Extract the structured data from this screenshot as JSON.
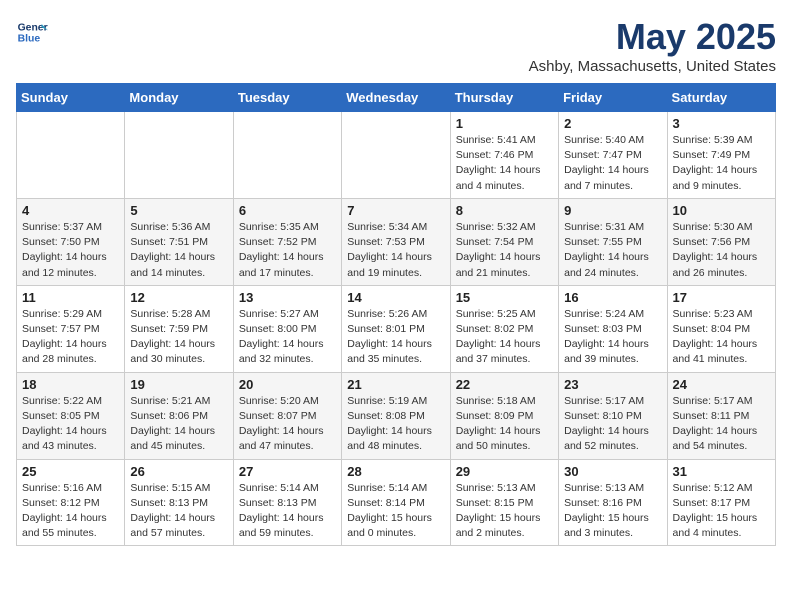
{
  "header": {
    "logo_line1": "General",
    "logo_line2": "Blue",
    "month_title": "May 2025",
    "location": "Ashby, Massachusetts, United States"
  },
  "weekdays": [
    "Sunday",
    "Monday",
    "Tuesday",
    "Wednesday",
    "Thursday",
    "Friday",
    "Saturday"
  ],
  "weeks": [
    [
      {
        "day": "",
        "info": ""
      },
      {
        "day": "",
        "info": ""
      },
      {
        "day": "",
        "info": ""
      },
      {
        "day": "",
        "info": ""
      },
      {
        "day": "1",
        "info": "Sunrise: 5:41 AM\nSunset: 7:46 PM\nDaylight: 14 hours\nand 4 minutes."
      },
      {
        "day": "2",
        "info": "Sunrise: 5:40 AM\nSunset: 7:47 PM\nDaylight: 14 hours\nand 7 minutes."
      },
      {
        "day": "3",
        "info": "Sunrise: 5:39 AM\nSunset: 7:49 PM\nDaylight: 14 hours\nand 9 minutes."
      }
    ],
    [
      {
        "day": "4",
        "info": "Sunrise: 5:37 AM\nSunset: 7:50 PM\nDaylight: 14 hours\nand 12 minutes."
      },
      {
        "day": "5",
        "info": "Sunrise: 5:36 AM\nSunset: 7:51 PM\nDaylight: 14 hours\nand 14 minutes."
      },
      {
        "day": "6",
        "info": "Sunrise: 5:35 AM\nSunset: 7:52 PM\nDaylight: 14 hours\nand 17 minutes."
      },
      {
        "day": "7",
        "info": "Sunrise: 5:34 AM\nSunset: 7:53 PM\nDaylight: 14 hours\nand 19 minutes."
      },
      {
        "day": "8",
        "info": "Sunrise: 5:32 AM\nSunset: 7:54 PM\nDaylight: 14 hours\nand 21 minutes."
      },
      {
        "day": "9",
        "info": "Sunrise: 5:31 AM\nSunset: 7:55 PM\nDaylight: 14 hours\nand 24 minutes."
      },
      {
        "day": "10",
        "info": "Sunrise: 5:30 AM\nSunset: 7:56 PM\nDaylight: 14 hours\nand 26 minutes."
      }
    ],
    [
      {
        "day": "11",
        "info": "Sunrise: 5:29 AM\nSunset: 7:57 PM\nDaylight: 14 hours\nand 28 minutes."
      },
      {
        "day": "12",
        "info": "Sunrise: 5:28 AM\nSunset: 7:59 PM\nDaylight: 14 hours\nand 30 minutes."
      },
      {
        "day": "13",
        "info": "Sunrise: 5:27 AM\nSunset: 8:00 PM\nDaylight: 14 hours\nand 32 minutes."
      },
      {
        "day": "14",
        "info": "Sunrise: 5:26 AM\nSunset: 8:01 PM\nDaylight: 14 hours\nand 35 minutes."
      },
      {
        "day": "15",
        "info": "Sunrise: 5:25 AM\nSunset: 8:02 PM\nDaylight: 14 hours\nand 37 minutes."
      },
      {
        "day": "16",
        "info": "Sunrise: 5:24 AM\nSunset: 8:03 PM\nDaylight: 14 hours\nand 39 minutes."
      },
      {
        "day": "17",
        "info": "Sunrise: 5:23 AM\nSunset: 8:04 PM\nDaylight: 14 hours\nand 41 minutes."
      }
    ],
    [
      {
        "day": "18",
        "info": "Sunrise: 5:22 AM\nSunset: 8:05 PM\nDaylight: 14 hours\nand 43 minutes."
      },
      {
        "day": "19",
        "info": "Sunrise: 5:21 AM\nSunset: 8:06 PM\nDaylight: 14 hours\nand 45 minutes."
      },
      {
        "day": "20",
        "info": "Sunrise: 5:20 AM\nSunset: 8:07 PM\nDaylight: 14 hours\nand 47 minutes."
      },
      {
        "day": "21",
        "info": "Sunrise: 5:19 AM\nSunset: 8:08 PM\nDaylight: 14 hours\nand 48 minutes."
      },
      {
        "day": "22",
        "info": "Sunrise: 5:18 AM\nSunset: 8:09 PM\nDaylight: 14 hours\nand 50 minutes."
      },
      {
        "day": "23",
        "info": "Sunrise: 5:17 AM\nSunset: 8:10 PM\nDaylight: 14 hours\nand 52 minutes."
      },
      {
        "day": "24",
        "info": "Sunrise: 5:17 AM\nSunset: 8:11 PM\nDaylight: 14 hours\nand 54 minutes."
      }
    ],
    [
      {
        "day": "25",
        "info": "Sunrise: 5:16 AM\nSunset: 8:12 PM\nDaylight: 14 hours\nand 55 minutes."
      },
      {
        "day": "26",
        "info": "Sunrise: 5:15 AM\nSunset: 8:13 PM\nDaylight: 14 hours\nand 57 minutes."
      },
      {
        "day": "27",
        "info": "Sunrise: 5:14 AM\nSunset: 8:13 PM\nDaylight: 14 hours\nand 59 minutes."
      },
      {
        "day": "28",
        "info": "Sunrise: 5:14 AM\nSunset: 8:14 PM\nDaylight: 15 hours\nand 0 minutes."
      },
      {
        "day": "29",
        "info": "Sunrise: 5:13 AM\nSunset: 8:15 PM\nDaylight: 15 hours\nand 2 minutes."
      },
      {
        "day": "30",
        "info": "Sunrise: 5:13 AM\nSunset: 8:16 PM\nDaylight: 15 hours\nand 3 minutes."
      },
      {
        "day": "31",
        "info": "Sunrise: 5:12 AM\nSunset: 8:17 PM\nDaylight: 15 hours\nand 4 minutes."
      }
    ]
  ]
}
